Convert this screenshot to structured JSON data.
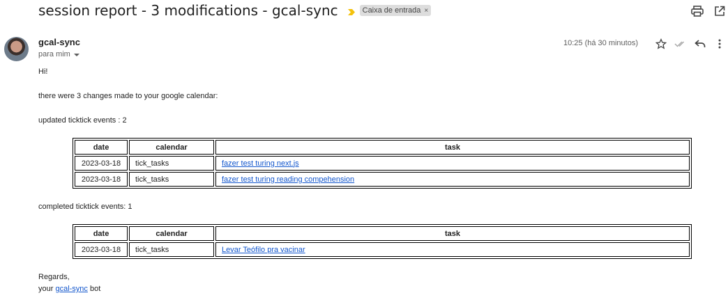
{
  "subject": {
    "title": "session report - 3 modifications - gcal-sync",
    "label": "Caixa de entrada",
    "label_remove": "×",
    "importance_color": "#f4c20d"
  },
  "toolbar": {
    "print_icon": "print-icon",
    "popout_icon": "open-in-new-window-icon"
  },
  "message": {
    "sender": "gcal-sync",
    "to": "para mim",
    "time": "10:25 (há 30 minutos)"
  },
  "body": {
    "greeting": "Hi!",
    "intro": "there were 3 changes made to your google calendar:",
    "updated_heading": "updated ticktick events : 2",
    "completed_heading": "completed ticktick events: 1",
    "table_headers": [
      "date",
      "calendar",
      "task"
    ],
    "updated_rows": [
      {
        "date": "2023-03-18",
        "calendar": "tick_tasks",
        "task": "fazer test turing next.js"
      },
      {
        "date": "2023-03-18",
        "calendar": "tick_tasks",
        "task": "fazer test turing reading compehension"
      }
    ],
    "completed_rows": [
      {
        "date": "2023-03-18",
        "calendar": "tick_tasks",
        "task": "Levar Teófilo pra vacinar"
      }
    ],
    "sign_off": "Regards,",
    "sign_prefix": "your",
    "sign_link": "gcal-sync",
    "sign_suffix": "bot"
  },
  "colors": {
    "link": "#1155cc",
    "label_bg": "#dddddd"
  }
}
